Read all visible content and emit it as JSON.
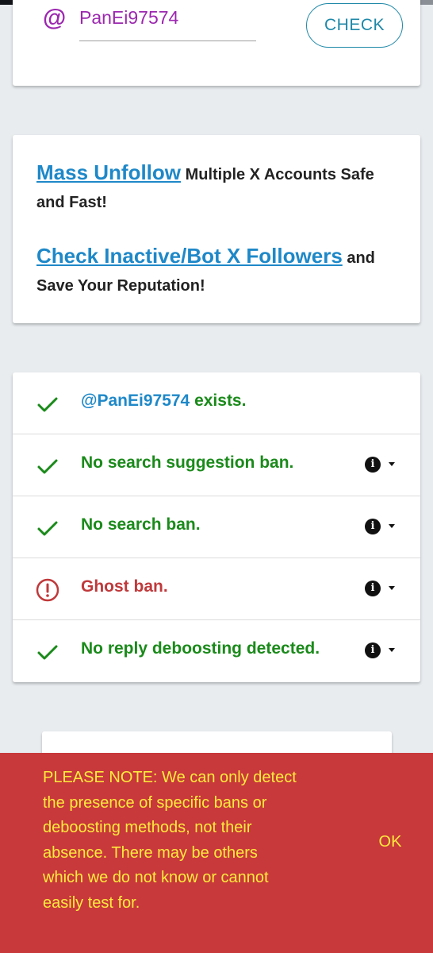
{
  "search": {
    "at_symbol": "@",
    "username_value": "PanEi97574",
    "check_label": "CHECK"
  },
  "promo": {
    "mass_unfollow_link": "Mass Unfollow",
    "mass_unfollow_text": " Multiple X Accounts Safe and Fast!",
    "inactive_link": "Check Inactive/Bot X Followers",
    "inactive_text": " and Save Your Reputation!"
  },
  "results": [
    {
      "status": "ok",
      "username": "@PanEi97574",
      "text": " exists.",
      "has_info": false
    },
    {
      "status": "ok",
      "text": "No search suggestion ban.",
      "has_info": true
    },
    {
      "status": "ok",
      "text": "No search ban.",
      "has_info": true
    },
    {
      "status": "warning",
      "text": "Ghost ban.",
      "has_info": true
    },
    {
      "status": "ok",
      "text": "No reply deboosting detected.",
      "has_info": true
    }
  ],
  "notice": {
    "text": "PLEASE NOTE: We can only detect the presence of specific bans or deboosting methods, not their absence. There may be others which we do not know or cannot easily test for.",
    "ok_label": "OK"
  },
  "colors": {
    "ok_green": "#1a8a1a",
    "warning_red": "#c0393b",
    "link_blue": "#1e88c8",
    "username_purple": "#9c27b0",
    "notice_bg": "#c8393b",
    "notice_text": "#ffeb3b"
  },
  "icons": {
    "ok": "check-icon",
    "warning": "alert-circle-icon",
    "info": "info-icon",
    "dropdown": "caret-down-icon"
  }
}
